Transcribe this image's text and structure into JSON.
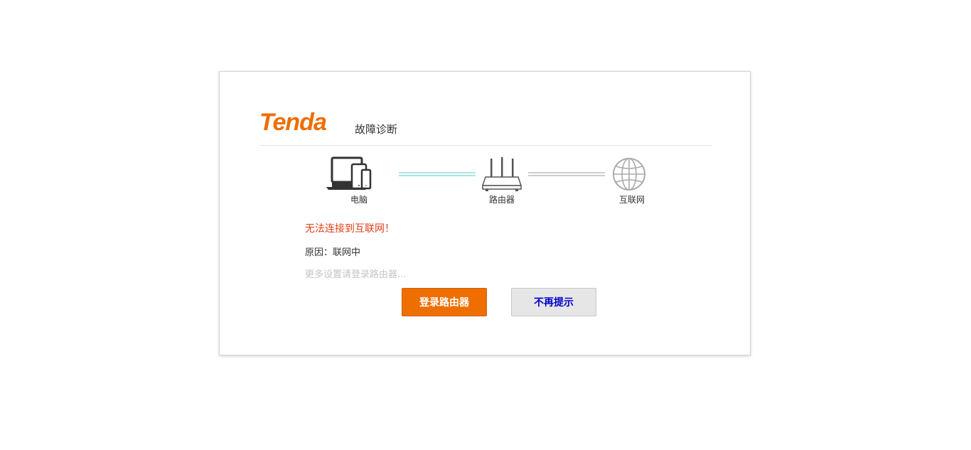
{
  "header": {
    "logo_text": "Tenda",
    "title": "故障诊断"
  },
  "diagram": {
    "nodes": [
      {
        "label": "电脑",
        "icon": "devices-icon"
      },
      {
        "label": "路由器",
        "icon": "router-icon"
      },
      {
        "label": "互联网",
        "icon": "globe-icon"
      }
    ],
    "links": [
      {
        "status": "connected",
        "color": "#5ac8d0"
      },
      {
        "status": "disconnected",
        "color": "#999999"
      }
    ]
  },
  "message": {
    "status": "无法连接到互联网！",
    "reason": "原因：联网中",
    "more": "更多设置请登录路由器..."
  },
  "buttons": {
    "login": "登录路由器",
    "dismiss": "不再提示"
  },
  "colors": {
    "brand": "#ee6e00",
    "error": "#e0411a"
  }
}
